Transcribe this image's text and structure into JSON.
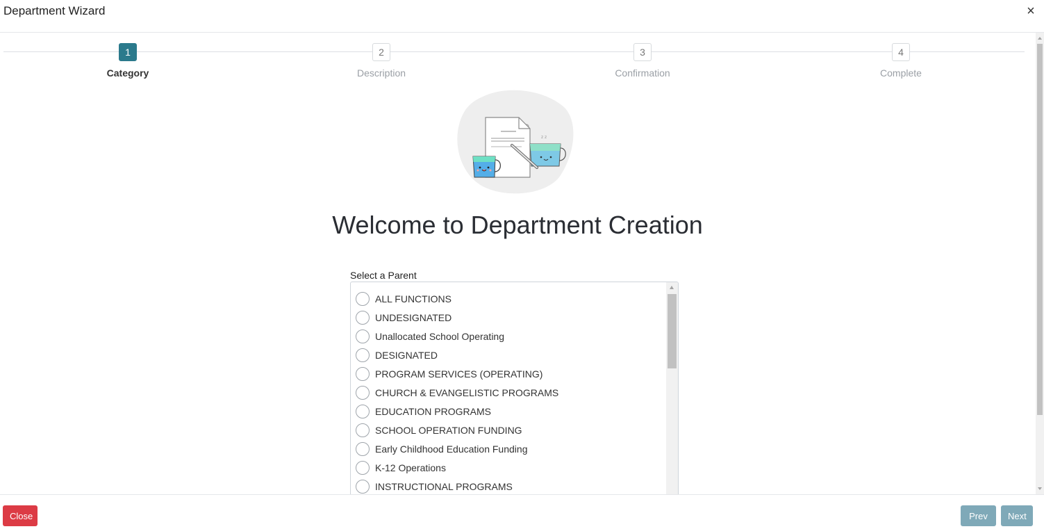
{
  "header": {
    "title": "Department Wizard",
    "close_icon": "×"
  },
  "stepper": {
    "steps": [
      {
        "number": "1",
        "label": "Category",
        "active": true
      },
      {
        "number": "2",
        "label": "Description",
        "active": false
      },
      {
        "number": "3",
        "label": "Confirmation",
        "active": false
      },
      {
        "number": "4",
        "label": "Complete",
        "active": false
      }
    ]
  },
  "main": {
    "welcome_title": "Welcome to Department Creation",
    "select_label": "Select a Parent",
    "parents": [
      "ALL FUNCTIONS",
      "UNDESIGNATED",
      "Unallocated School Operating",
      "DESIGNATED",
      "PROGRAM SERVICES (OPERATING)",
      "CHURCH & EVANGELISTIC PROGRAMS",
      "EDUCATION PROGRAMS",
      "SCHOOL OPERATION FUNDING",
      "Early Childhood Education Funding",
      "K-12 Operations",
      "INSTRUCTIONAL PROGRAMS"
    ]
  },
  "footer": {
    "close_label": "Close",
    "prev_label": "Prev",
    "next_label": "Next"
  },
  "colors": {
    "accent": "#2b7a8c",
    "danger": "#dc3b45",
    "nav_button": "#7fa9b8"
  }
}
